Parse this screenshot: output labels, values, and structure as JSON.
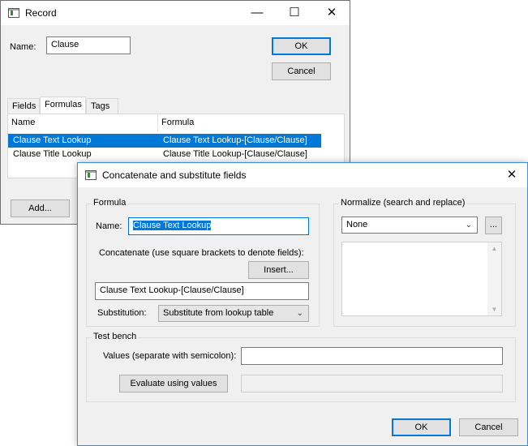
{
  "record_window": {
    "title": "Record",
    "name_label": "Name:",
    "name_value": "Clause",
    "ok_label": "OK",
    "cancel_label": "Cancel",
    "tabs": [
      "Fields",
      "Formulas",
      "Tags"
    ],
    "active_tab": "Formulas",
    "columns": [
      "Name",
      "Formula"
    ],
    "rows": [
      {
        "name": "Clause Text Lookup",
        "formula": "Clause Text Lookup-[Clause/Clause]",
        "selected": true
      },
      {
        "name": "Clause Title Lookup",
        "formula": "Clause Title Lookup-[Clause/Clause]",
        "selected": false
      }
    ],
    "add_label": "Add..."
  },
  "dialog": {
    "title": "Concatenate and substitute fields",
    "formula_group": "Formula",
    "name_label": "Name:",
    "name_value": "Clause Text Lookup",
    "concat_label": "Concatenate (use square brackets to denote fields):",
    "insert_label": "Insert...",
    "concat_value": "Clause Text Lookup-[Clause/Clause]",
    "substitution_label": "Substitution:",
    "substitution_value": "Substitute from lookup table",
    "normalize_group": "Normalize (search and replace)",
    "normalize_value": "None",
    "normalize_more_label": "...",
    "testbench_group": "Test bench",
    "values_label": "Values (separate with semicolon):",
    "values_value": "",
    "evaluate_label": "Evaluate using values",
    "result_value": "",
    "ok_label": "OK",
    "cancel_label": "Cancel"
  },
  "icons": {
    "app": "app-window-icon",
    "minimize": "minimize-icon",
    "maximize": "maximize-icon",
    "close": "close-icon",
    "dropdown": "chevron-down-icon"
  },
  "colors": {
    "selection": "#0078d7",
    "dialog_border": "#3c8ed6",
    "window_bg": "#f0f0f0"
  }
}
